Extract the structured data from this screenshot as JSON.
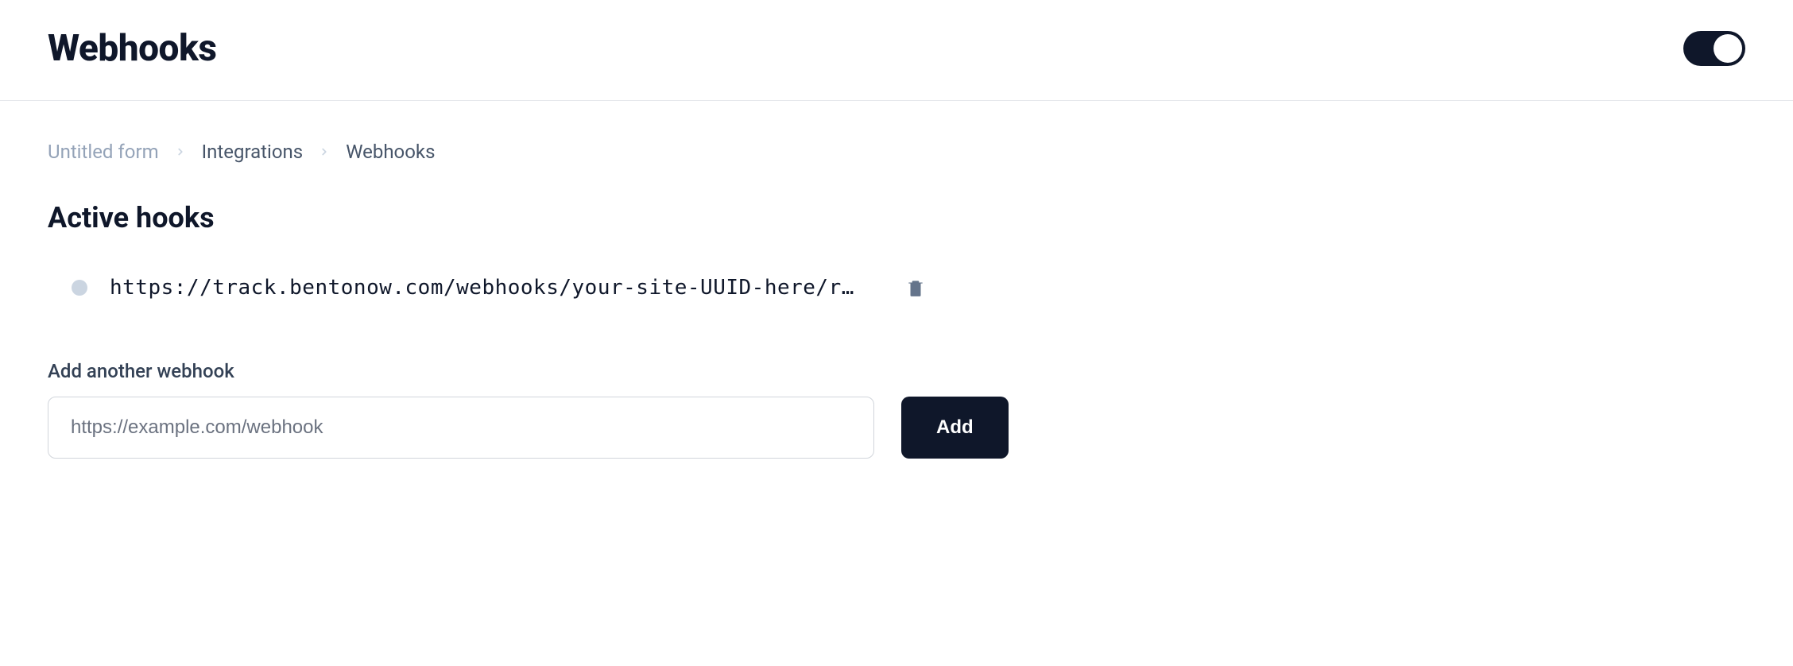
{
  "header": {
    "title": "Webhooks",
    "toggle_on": true
  },
  "breadcrumb": {
    "items": [
      {
        "label": "Untitled form",
        "muted": true
      },
      {
        "label": "Integrations",
        "muted": false
      },
      {
        "label": "Webhooks",
        "muted": false
      }
    ]
  },
  "active_hooks": {
    "title": "Active hooks",
    "items": [
      {
        "url": "https://track.bentonow.com/webhooks/your-site-UUID-here/r…"
      }
    ]
  },
  "add": {
    "label": "Add another webhook",
    "placeholder": "https://example.com/webhook",
    "button_label": "Add"
  }
}
